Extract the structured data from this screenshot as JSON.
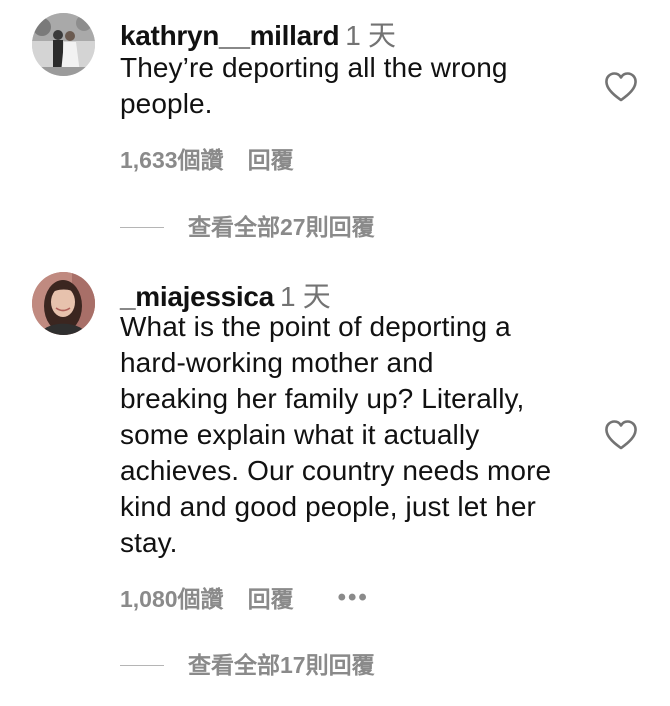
{
  "comments": [
    {
      "username": "kathryn__millard",
      "time": "1 天",
      "text_lines": [
        "They’re deporting all the wrong",
        "people."
      ],
      "likes": "1,633個讚",
      "reply_label": "回覆",
      "view_replies": "查看全部27則回覆"
    },
    {
      "username": "_miajessica",
      "time": "1 天",
      "text_lines": [
        "What is the point of deporting a",
        "hard-working mother and",
        "breaking her family up? Literally,",
        "some explain what it actually",
        "achieves. Our country needs more",
        "kind and good people, just let her",
        "stay."
      ],
      "likes": "1,080個讚",
      "reply_label": "回覆",
      "more_label": "•••",
      "view_replies": "查看全部17則回覆"
    }
  ],
  "icons": {
    "like": "heart-outline-icon",
    "more": "ellipsis-icon"
  },
  "colors": {
    "text": "#111111",
    "secondary": "#8a8a8a",
    "divider": "#b5b5b5"
  }
}
